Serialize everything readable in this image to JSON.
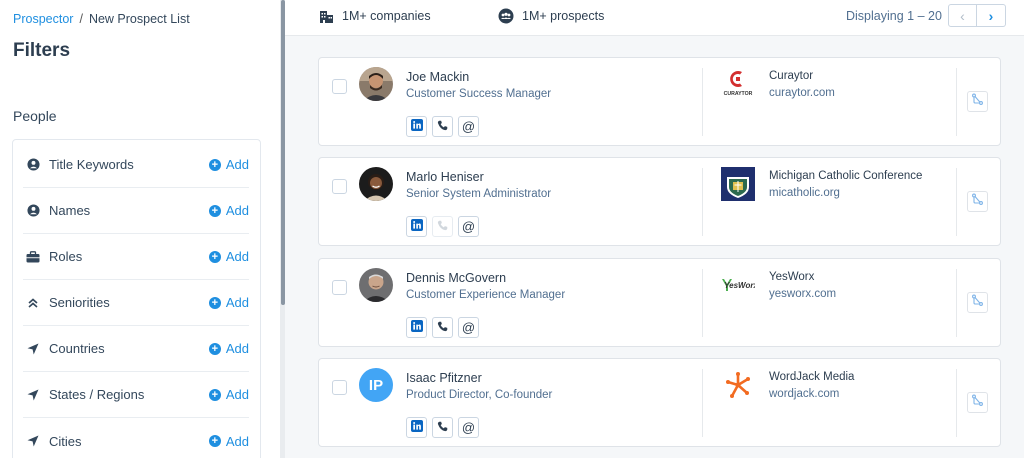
{
  "breadcrumb": {
    "root": "Prospector",
    "separator": "/",
    "current": "New Prospect List"
  },
  "sidebar": {
    "title": "Filters",
    "section_title": "People",
    "add_label": "Add",
    "filters": [
      {
        "label": "Title Keywords",
        "icon": "person-icon"
      },
      {
        "label": "Names",
        "icon": "person-icon"
      },
      {
        "label": "Roles",
        "icon": "briefcase-icon"
      },
      {
        "label": "Seniorities",
        "icon": "chevrons-up-icon"
      },
      {
        "label": "Countries",
        "icon": "location-arrow-icon"
      },
      {
        "label": "States / Regions",
        "icon": "location-arrow-icon"
      },
      {
        "label": "Cities",
        "icon": "location-arrow-icon"
      }
    ]
  },
  "topbar": {
    "companies": "1M+ companies",
    "prospects": "1M+ prospects",
    "displaying": "Displaying 1 – 20",
    "prev_icon": "chevron-left-icon",
    "next_icon": "chevron-right-icon"
  },
  "colors": {
    "accent": "#1f8fe0",
    "linkedin": "#0a66c2",
    "text": "#33475b",
    "muted": "#516f90"
  },
  "prospects": [
    {
      "name": "Joe Mackin",
      "title": "Customer Success Manager",
      "company": "Curaytor",
      "domain": "curaytor.com",
      "phone_enabled": true,
      "avatar": "photo"
    },
    {
      "name": "Marlo Heniser",
      "title": "Senior System Administrator",
      "company": "Michigan Catholic Conference",
      "domain": "micatholic.org",
      "phone_enabled": false,
      "avatar": "photo"
    },
    {
      "name": "Dennis McGovern",
      "title": "Customer Experience Manager",
      "company": "YesWorx",
      "domain": "yesworx.com",
      "phone_enabled": true,
      "avatar": "photo"
    },
    {
      "name": "Isaac Pfitzner",
      "title": "Product Director, Co-founder",
      "company": "WordJack Media",
      "domain": "wordjack.com",
      "phone_enabled": true,
      "avatar": "initials",
      "initials": "IP"
    }
  ],
  "logos": {
    "curaytor_text": "CURAYTOR",
    "yesworx_text": "YesWorx"
  }
}
